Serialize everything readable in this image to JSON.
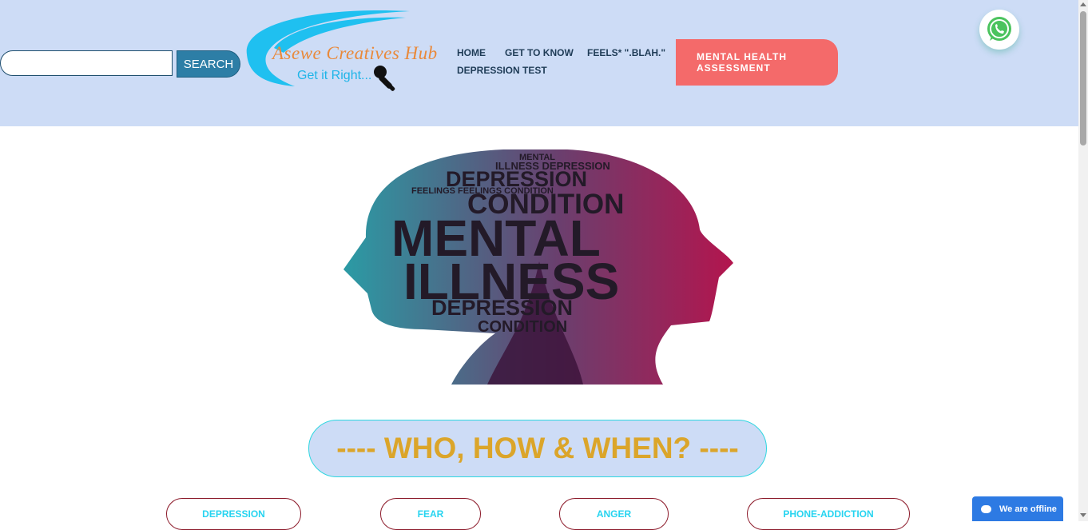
{
  "search": {
    "value": "",
    "button_label": "SEARCH"
  },
  "logo": {
    "name": "Asewe Creatives Hub",
    "tagline": "Get it Right..."
  },
  "nav": [
    {
      "label": "HOME"
    },
    {
      "label": "GET TO KNOW"
    },
    {
      "label": "FEELS* \".BLAH.\""
    },
    {
      "label": "DEPRESSION TEST"
    }
  ],
  "cta": {
    "label": "MENTAL HEALTH ASSESSMENT"
  },
  "hero": {
    "words": {
      "w1": "MENTAL",
      "w2": "ILLNESS DEPRESSION",
      "w3": "DEPRESSION",
      "w4": "FEELINGS FEELINGS CONDITION",
      "w5": "CONDITION",
      "w6": "MENTAL",
      "w7": "ILLNESS",
      "w8": "DEPRESSION",
      "w9": "CONDITION"
    }
  },
  "section": {
    "heading": "---- WHO, HOW & WHEN? ----"
  },
  "topics": [
    {
      "label": "DEPRESSION"
    },
    {
      "label": "FEAR"
    },
    {
      "label": "ANGER"
    },
    {
      "label": "PHONE-ADDICTION"
    }
  ],
  "chat": {
    "status": "We are offline"
  },
  "colors": {
    "header_bg": "#cddcf6",
    "accent_coral": "#f46a6a",
    "heading_gold": "#dba52a",
    "topic_cyan": "#27d4f0",
    "chat_blue": "#2d7ae3"
  },
  "icons": [
    "whatsapp-icon",
    "microphone-icon",
    "chat-bubble-icon"
  ]
}
